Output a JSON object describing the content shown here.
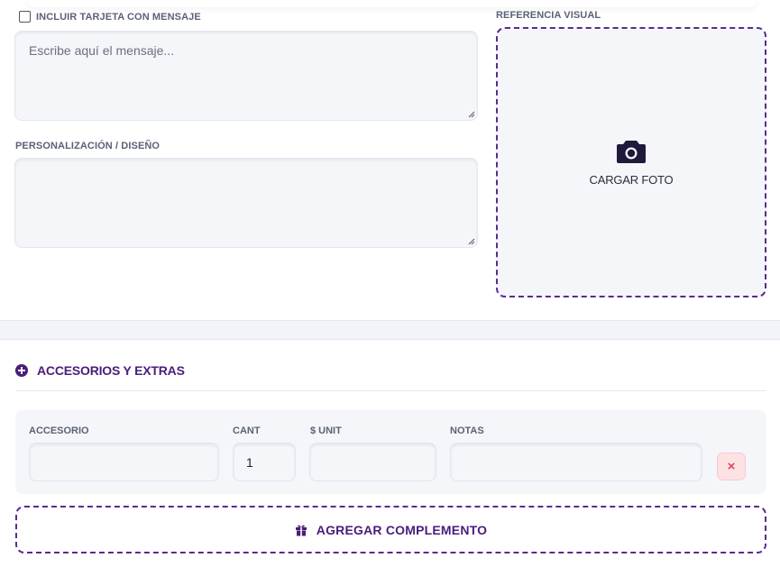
{
  "card": {
    "checkbox_label": "INCLUIR TARJETA CON MENSAJE",
    "checked": false,
    "message_placeholder": "Escribe aquí el mensaje..."
  },
  "personalization": {
    "label": "PERSONALIZACIÓN / DISEÑO",
    "value": ""
  },
  "visual_reference": {
    "label": "REFERENCIA VISUAL",
    "upload_icon": "camera-icon",
    "upload_label": "CARGAR FOTO"
  },
  "accessories": {
    "title": "ACCESORIOS Y EXTRAS",
    "title_icon": "plus-circle-icon",
    "columns": {
      "accessory": "ACCESORIO",
      "qty": "CANT",
      "unit_price": "$ UNIT",
      "notes": "NOTAS"
    },
    "rows": [
      {
        "accessory": "",
        "qty": "1",
        "unit_price": "",
        "notes": "",
        "remove_label": "×"
      }
    ],
    "add_button_icon": "gift-icon",
    "add_button_label": "AGREGAR COMPLEMENTO"
  },
  "colors": {
    "accent": "#4a1d7a",
    "dashed_border": "#5b2a8f",
    "danger": "#d9475a",
    "field_bg": "#f4f6fa"
  }
}
